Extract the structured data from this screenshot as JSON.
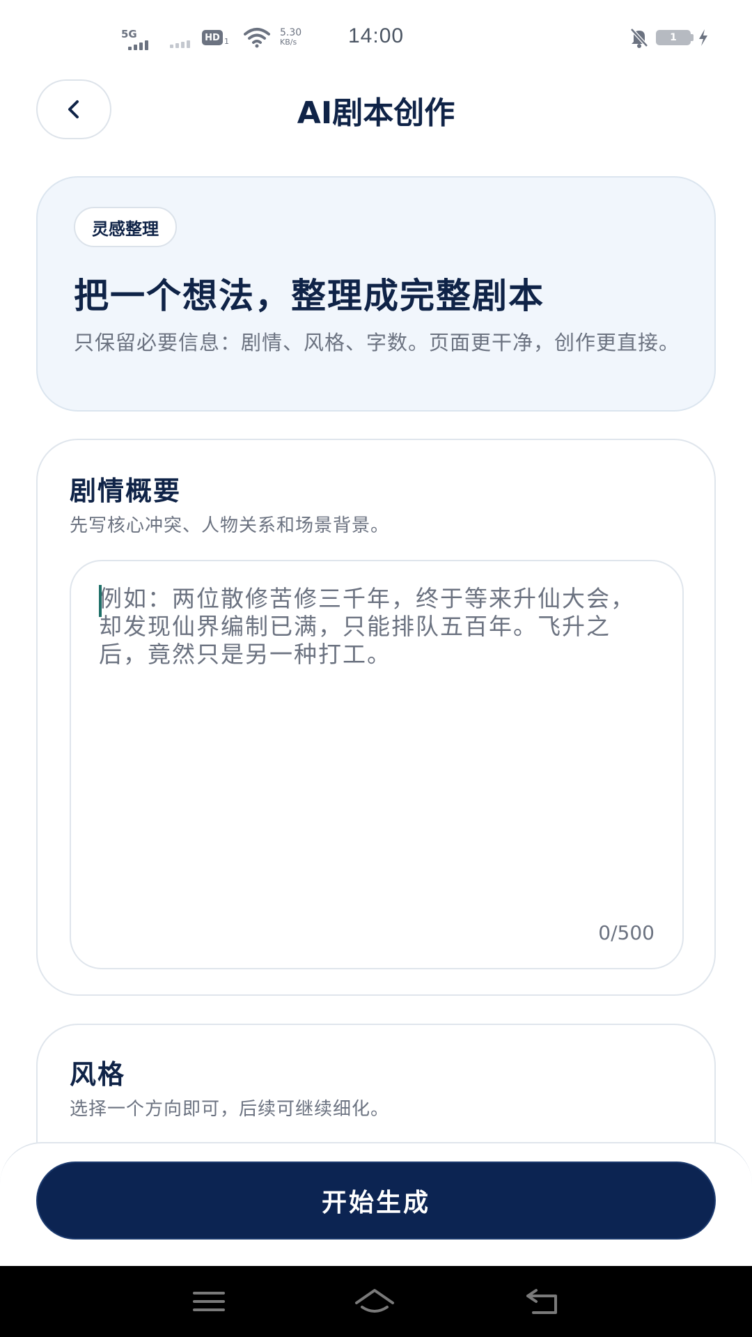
{
  "status_bar": {
    "network_label": "5G",
    "hd_label": "HD",
    "hd_sub": "1",
    "speed_value": "5.30",
    "speed_unit": "KB/s",
    "time": "14:00",
    "battery_level": "1"
  },
  "header": {
    "title": "AI剧本创作",
    "back_icon": "chevron-left-icon"
  },
  "intro": {
    "tag": "灵感整理",
    "title": "把一个想法，整理成完整剧本",
    "description": "只保留必要信息：剧情、风格、字数。页面更干净，创作更直接。"
  },
  "plot": {
    "title": "剧情概要",
    "subtitle": "先写核心冲突、人物关系和场景背景。",
    "placeholder": "例如：两位散修苦修三千年，终于等来升仙大会，却发现仙界编制已满，只能排队五百年。飞升之后，竟然只是另一种打工。",
    "value": "",
    "counter": "0/500"
  },
  "style": {
    "title": "风格",
    "subtitle": "选择一个方向即可，后续可继续细化。"
  },
  "actions": {
    "generate_label": "开始生成"
  },
  "nav": {
    "menu_icon": "menu-icon",
    "home_icon": "home-icon",
    "back_icon": "back-icon"
  },
  "colors": {
    "primary": "#0c2452",
    "title_text": "#0f2347",
    "muted_text": "#6b7280",
    "intro_bg": "#f1f6fc",
    "caret": "#1f6f68"
  }
}
